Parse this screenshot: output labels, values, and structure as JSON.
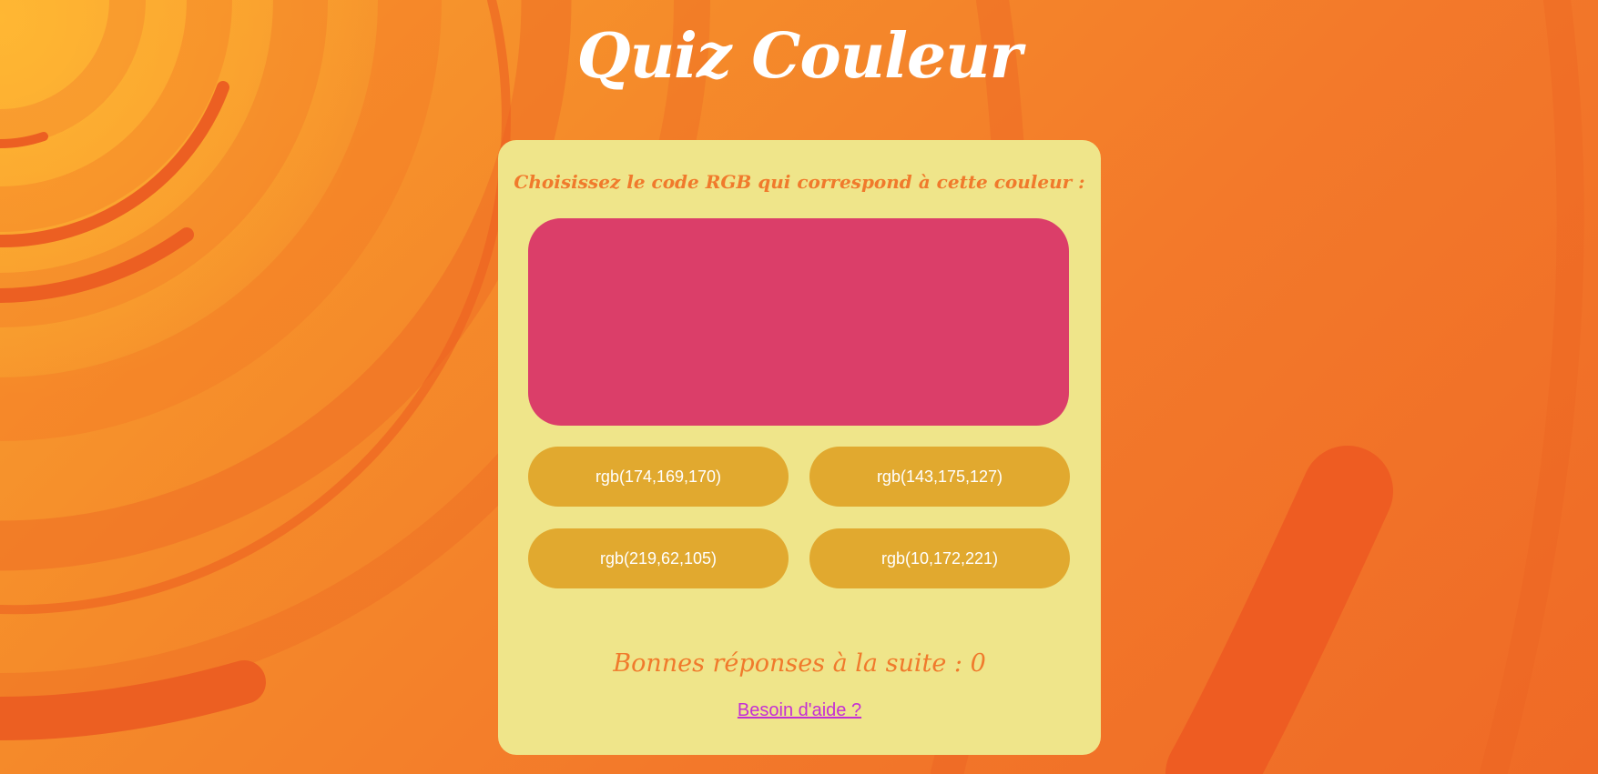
{
  "title": "Quiz Couleur",
  "prompt": "Choisissez le code RGB qui correspond à cette couleur :",
  "target_color": "#db3e69",
  "options": [
    {
      "label": "rgb(174,169,170)"
    },
    {
      "label": "rgb(143,175,127)"
    },
    {
      "label": "rgb(219,62,105)"
    },
    {
      "label": "rgb(10,172,221)"
    }
  ],
  "streak": {
    "text": "Bonnes réponses à la suite : 0"
  },
  "help_link": "Besoin d'aide ?",
  "colors": {
    "card_bg": "#efe58a",
    "option_bg": "#e1a92f",
    "accent_text": "#f07a2c",
    "link": "#c42fd4",
    "page_bg": "#f3792a"
  }
}
